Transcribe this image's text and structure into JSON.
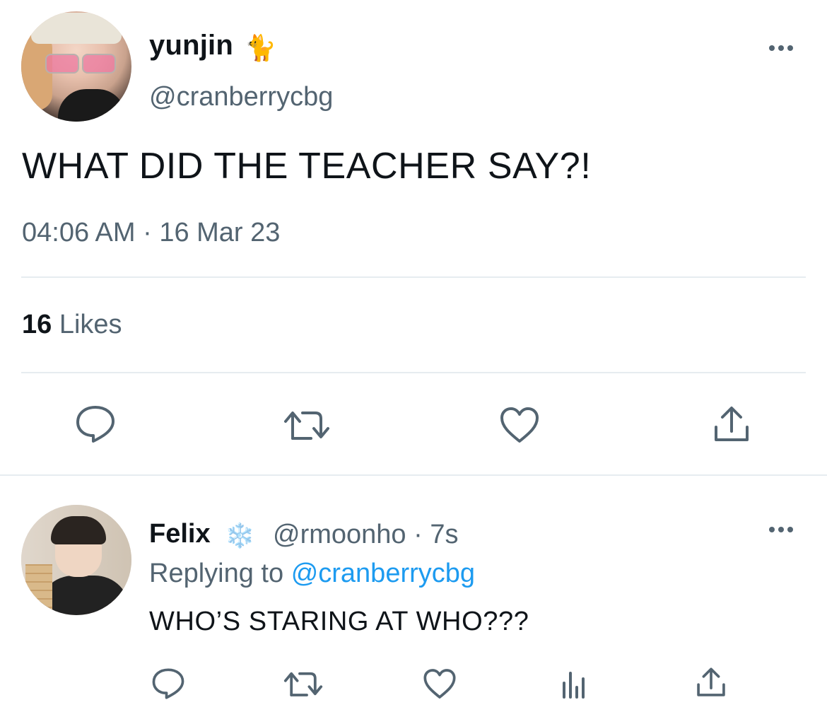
{
  "tweet": {
    "author": {
      "display_name": "yunjin",
      "name_emoji": "🐈",
      "handle": "@cranberrycbg"
    },
    "text": "WHAT DID THE TEACHER SAY?!",
    "timestamp": "04:06 AM · 16 Mar 23",
    "likes": {
      "count": "16",
      "label": "Likes"
    },
    "actions": [
      "reply-icon",
      "retweet-icon",
      "like-icon",
      "share-icon"
    ]
  },
  "reply": {
    "author": {
      "display_name": "Felix",
      "name_emoji": "❄️",
      "handle_time": "@rmoonho · 7s"
    },
    "replying_prefix": "Replying to",
    "replying_to": "@cranberrycbg",
    "text": "WHO’S STARING AT WHO???",
    "actions": [
      "reply-icon",
      "retweet-icon",
      "like-icon",
      "analytics-icon",
      "share-icon"
    ]
  },
  "colors": {
    "text_primary": "#0f1419",
    "text_secondary": "#536471",
    "link": "#1d9bf0",
    "divider": "#e6ecf0"
  }
}
